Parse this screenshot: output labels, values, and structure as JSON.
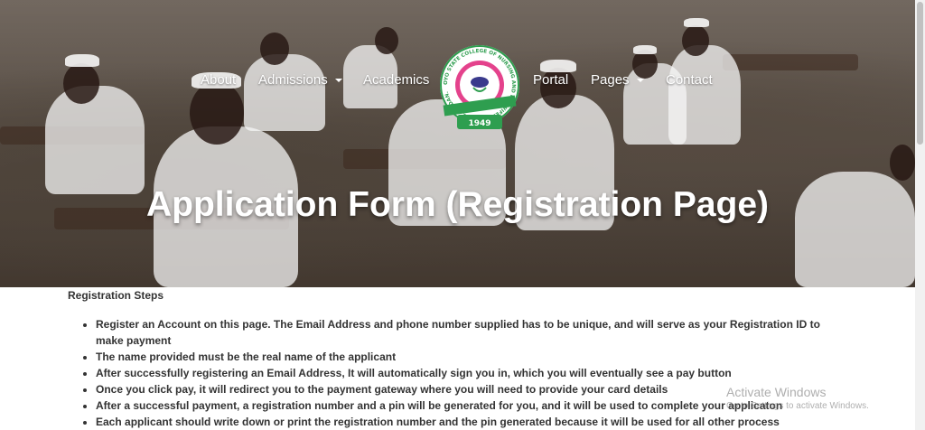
{
  "nav": {
    "items": [
      {
        "label": "About",
        "dropdown": false
      },
      {
        "label": "Admissions",
        "dropdown": true
      },
      {
        "label": "Academics",
        "dropdown": false
      },
      {
        "label": "Portal",
        "dropdown": false
      },
      {
        "label": "Pages",
        "dropdown": true
      },
      {
        "label": "Contact",
        "dropdown": false
      }
    ]
  },
  "logo": {
    "ring_text": "OYO STATE COLLEGE OF NURSING AND MIDWIFERY ELEYELE, IBADAN.",
    "year": "1949",
    "colors": {
      "pink": "#e4428c",
      "green": "#2e9e4f",
      "blue": "#3a3a8c"
    }
  },
  "hero": {
    "title": "Application Form (Registration Page)"
  },
  "steps": {
    "title": "Registration Steps",
    "items": [
      "Register an Account on this page. The Email Address and phone number supplied has to be unique, and will serve as your Registration ID to make payment",
      "The name provided must be the real name of the applicant",
      "After successfully registering an Email Address, It will automatically sign you in, which you will eventually see a pay button",
      "Once you click pay, it will redirect you to the payment gateway where you will need to provide your card details",
      "After a successful payment, a registration number and a pin will be generated for you, and it will be used to complete your applicaton",
      "Each applicant should write down or print the registration number and the pin generated because it will be used for all other process"
    ]
  },
  "watermark": {
    "title": "Activate Windows",
    "subtitle": "Go to Settings to activate Windows."
  }
}
